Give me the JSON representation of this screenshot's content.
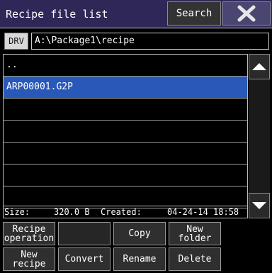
{
  "header": {
    "title": "Recipe file list",
    "search_label": "Search"
  },
  "path": {
    "drive_label": "DRV",
    "current_path": "A:\\Package1\\recipe"
  },
  "files": [
    {
      "name": "..",
      "selected": false
    },
    {
      "name": "ARP00001.G2P",
      "selected": true
    },
    {
      "name": "",
      "selected": false
    },
    {
      "name": "",
      "selected": false
    },
    {
      "name": "",
      "selected": false
    },
    {
      "name": "",
      "selected": false
    },
    {
      "name": "",
      "selected": false
    }
  ],
  "info": {
    "size_label": "Size:",
    "size_value": "320.0 B",
    "created_label": "Created:",
    "created_value": "04-24-14 18:58"
  },
  "buttons": {
    "recipe_operation": "Recipe\noperation",
    "empty": "",
    "copy": "Copy",
    "new_folder": "New\nfolder",
    "new_recipe": "New\nrecipe",
    "convert": "Convert",
    "rename": "Rename",
    "delete": "Delete"
  },
  "colors": {
    "title_bg": "#2e2758",
    "selection": "#2858b8",
    "close_bg": "#4a4672"
  },
  "icons": {
    "close": "close-icon",
    "scroll_up": "triangle-up-icon",
    "scroll_down": "triangle-down-icon"
  }
}
